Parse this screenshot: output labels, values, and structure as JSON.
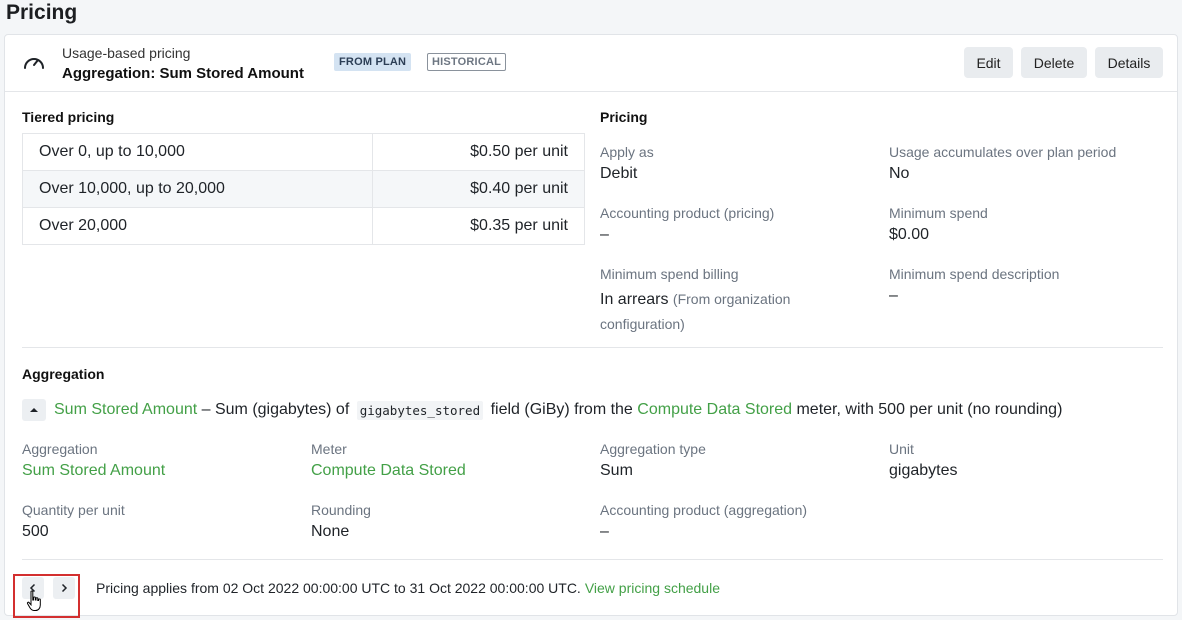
{
  "page": {
    "title": "Pricing"
  },
  "header": {
    "kind": "Usage-based pricing",
    "title": "Aggregation: Sum Stored Amount",
    "badges": [
      "FROM PLAN",
      "HISTORICAL"
    ],
    "buttons": {
      "edit": "Edit",
      "delete": "Delete",
      "details": "Details"
    }
  },
  "tiered": {
    "label": "Tiered pricing",
    "rows": [
      {
        "range": "Over 0, up to 10,000",
        "price": "$0.50 per unit"
      },
      {
        "range": "Over 10,000, up to 20,000",
        "price": "$0.40 per unit"
      },
      {
        "range": "Over 20,000",
        "price": "$0.35 per unit"
      }
    ]
  },
  "pricing": {
    "label": "Pricing",
    "apply_as": {
      "label": "Apply as",
      "value": "Debit"
    },
    "usage_accumulates": {
      "label": "Usage accumulates over plan period",
      "value": "No"
    },
    "accounting_product": {
      "label": "Accounting product (pricing)",
      "value": "–"
    },
    "minimum_spend": {
      "label": "Minimum spend",
      "value": "$0.00"
    },
    "minimum_spend_billing": {
      "label": "Minimum spend billing",
      "value": "In arrears",
      "note": "(From organization configuration)"
    },
    "minimum_spend_description": {
      "label": "Minimum spend description",
      "value": "–"
    }
  },
  "aggregation": {
    "label": "Aggregation",
    "summary": {
      "name": "Sum Stored Amount",
      "text1": " – Sum (gigabytes) of ",
      "field": "gigabytes_stored",
      "text2": " field (GiBy) from the ",
      "meter": "Compute Data Stored",
      "text3": " meter, with 500 per unit (no rounding)"
    },
    "fields": {
      "aggregation": {
        "label": "Aggregation",
        "value": "Sum Stored Amount"
      },
      "meter": {
        "label": "Meter",
        "value": "Compute Data Stored"
      },
      "aggregation_type": {
        "label": "Aggregation type",
        "value": "Sum"
      },
      "unit": {
        "label": "Unit",
        "value": "gigabytes"
      },
      "quantity_per_unit": {
        "label": "Quantity per unit",
        "value": "500"
      },
      "rounding": {
        "label": "Rounding",
        "value": "None"
      },
      "accounting_product": {
        "label": "Accounting product (aggregation)",
        "value": "–"
      }
    }
  },
  "footer": {
    "text": "Pricing applies from 02 Oct 2022 00:00:00 UTC to 31 Oct 2022 00:00:00 UTC.",
    "link": "View pricing schedule"
  },
  "colors": {
    "accent_green": "#43a047",
    "badge_blue": "#d4e3f2",
    "highlight_red": "#d32f2f"
  },
  "icons": [
    "gauge-icon",
    "chevron-up-icon",
    "chevron-left-icon",
    "chevron-right-icon",
    "hand-cursor-icon"
  ]
}
